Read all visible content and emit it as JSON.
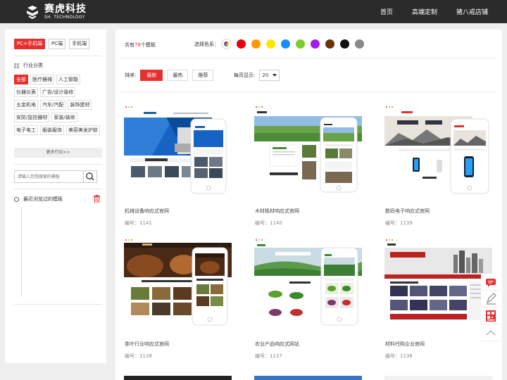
{
  "brand": {
    "name_cn": "赛虎科技",
    "name_en": "SH. TECHNOLOGY"
  },
  "nav": [
    "首页",
    "高端定制",
    "猪八戒店铺"
  ],
  "sidebar": {
    "device_tabs": [
      {
        "label": "PC+手机端",
        "active": true
      },
      {
        "label": "PC端",
        "active": false
      },
      {
        "label": "手机端",
        "active": false
      }
    ],
    "category_title": "行业分类",
    "categories": [
      {
        "label": "全部",
        "active": true
      },
      {
        "label": "医疗器械"
      },
      {
        "label": "人工智能"
      },
      {
        "label": "仪器仪表"
      },
      {
        "label": "广告/设计装修"
      },
      {
        "label": "五金机电"
      },
      {
        "label": "汽车/汽配"
      },
      {
        "label": "装饰建材"
      },
      {
        "label": "安防/监控器材"
      },
      {
        "label": "家装/装修"
      },
      {
        "label": "电子电工"
      },
      {
        "label": "服装服饰"
      },
      {
        "label": "美容美发护肤"
      }
    ],
    "more_label": "更多行业>>",
    "search_placeholder": "请输入您想搜索的模板",
    "recent_label": "最近浏览过的模板"
  },
  "toolbar": {
    "count_prefix": "共有",
    "count_value": "78",
    "count_suffix": "个模板",
    "color_label": "选择色系：",
    "colors": [
      "rainbow",
      "#e60012",
      "#ff9900",
      "#ffe600",
      "#1a8cff",
      "#7ccc2e",
      "#a11fe8",
      "#6b3306",
      "#111111",
      "#888888"
    ],
    "sort_label": "排序:",
    "sort_options": [
      {
        "label": "最新",
        "active": true
      },
      {
        "label": "最热",
        "active": false
      },
      {
        "label": "推荐",
        "active": false
      }
    ],
    "perpage_label": "每页显示:",
    "perpage_value": "20"
  },
  "templates": [
    {
      "title": "机械设备响应式官网",
      "code": "编号：1141",
      "theme": "blue"
    },
    {
      "title": "木材板材响应式官网",
      "code": "编号：1140",
      "theme": "green"
    },
    {
      "title": "数码电子响应式官网",
      "code": "编号：1139",
      "theme": "phone"
    },
    {
      "title": "茶叶行业响应式官网",
      "code": "编号：1138",
      "theme": "tea"
    },
    {
      "title": "农业产品响应式网站",
      "code": "编号：1137",
      "theme": "farm"
    },
    {
      "title": "材料代购企业官网",
      "code": "编号：1136",
      "theme": "city"
    }
  ],
  "float_tools": [
    "chat-icon",
    "edit-icon",
    "qrcode-icon",
    "back-top-icon"
  ]
}
